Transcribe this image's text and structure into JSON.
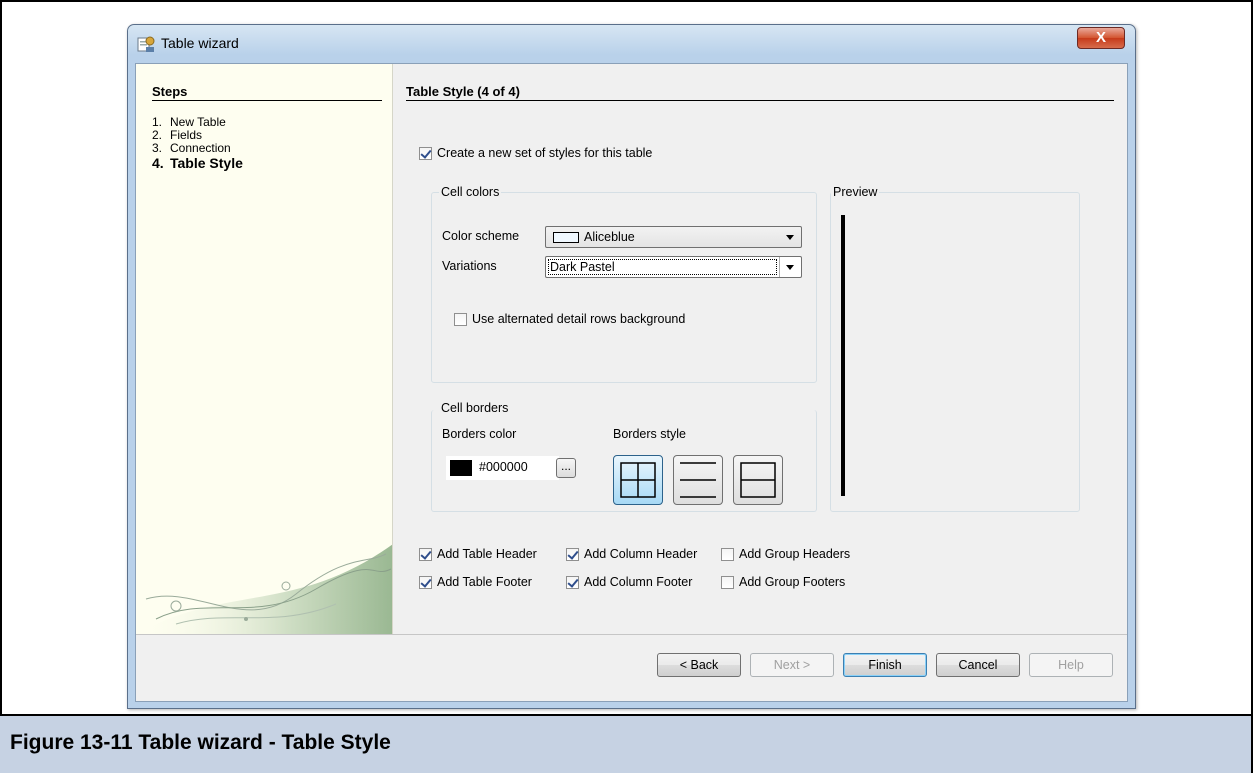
{
  "window": {
    "title": "Table wizard",
    "close_symbol": "X"
  },
  "steps": {
    "title": "Steps",
    "items": [
      {
        "num": "1.",
        "label": "New Table"
      },
      {
        "num": "2.",
        "label": "Fields"
      },
      {
        "num": "3.",
        "label": "Connection"
      },
      {
        "num": "4.",
        "label": "Table Style",
        "current": true
      }
    ]
  },
  "content": {
    "section_title": "Table Style (4 of 4)",
    "create_styles": {
      "label": "Create a new set of styles for this table",
      "checked": true
    },
    "cell_colors": {
      "group_label": "Cell colors",
      "color_scheme_label": "Color scheme",
      "color_scheme_value": "Aliceblue",
      "color_scheme_swatch": "#f0f8ff",
      "variations_label": "Variations",
      "variations_value": "Dark Pastel",
      "alternated_rows": {
        "label": "Use alternated detail rows background",
        "checked": false
      }
    },
    "cell_borders": {
      "group_label": "Cell borders",
      "borders_color_label": "Borders color",
      "borders_color_value": "#000000",
      "borders_color_swatch": "#000000",
      "browse_label": "...",
      "borders_style_label": "Borders style",
      "selected_style": "all-borders"
    },
    "preview": {
      "group_label": "Preview",
      "colors": {
        "dark": "#8ba8c6",
        "light": "#ccd9e5",
        "white": "#ffffff"
      }
    },
    "options": [
      {
        "label": "Add Table Header",
        "checked": true
      },
      {
        "label": "Add Column Header",
        "checked": true
      },
      {
        "label": "Add Group Headers",
        "checked": false
      },
      {
        "label": "Add Table Footer",
        "checked": true
      },
      {
        "label": "Add Column Footer",
        "checked": true
      },
      {
        "label": "Add Group Footers",
        "checked": false
      }
    ]
  },
  "buttons": {
    "back": "< Back",
    "next": "Next >",
    "finish": "Finish",
    "cancel": "Cancel",
    "help": "Help"
  },
  "caption": "Figure 13-11  Table wizard - Table Style"
}
